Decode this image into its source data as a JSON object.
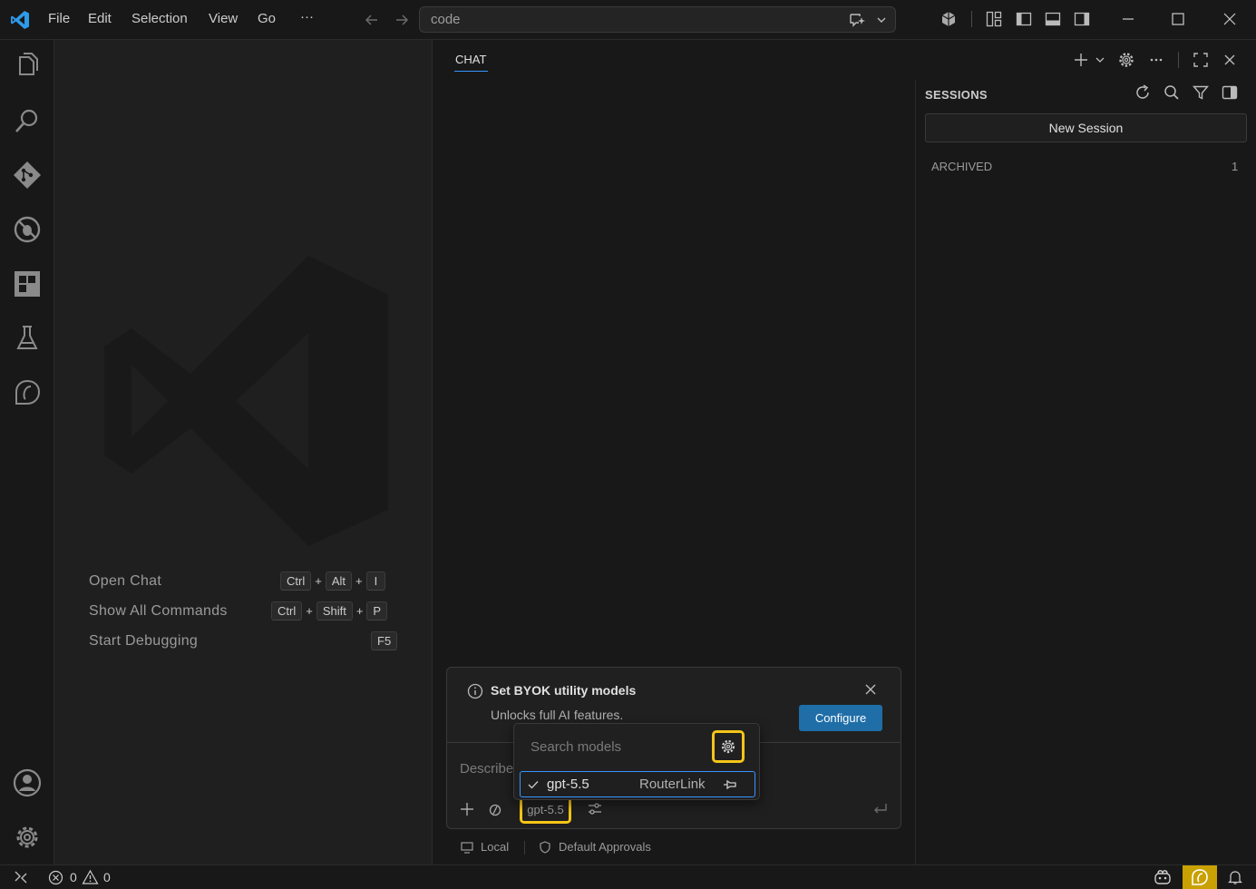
{
  "titlebar": {
    "menu": [
      "File",
      "Edit",
      "Selection",
      "View",
      "Go",
      "···"
    ],
    "search_text": "code"
  },
  "activity_bar": {
    "icons": [
      "explorer-icon",
      "search-icon",
      "source-control-icon",
      "run-debug-icon",
      "extensions-icon",
      "testing-icon",
      "chat-sessions-icon",
      "account-icon",
      "settings-gear-icon"
    ]
  },
  "editor": {
    "hints": [
      {
        "label": "Open Chat",
        "keys": [
          "Ctrl",
          "Alt",
          "I"
        ]
      },
      {
        "label": "Show All Commands",
        "keys": [
          "Ctrl",
          "Shift",
          "P"
        ]
      },
      {
        "label": "Start Debugging",
        "keys": [
          "F5"
        ]
      }
    ],
    "plus": "+"
  },
  "chat": {
    "tab_label": "CHAT",
    "sessions": {
      "title": "SESSIONS",
      "new_session_label": "New Session",
      "archived_label": "ARCHIVED",
      "archived_count": "1"
    },
    "notification": {
      "title": "Set BYOK utility models",
      "description": "Unlocks full AI features.",
      "button_label": "Configure"
    },
    "input": {
      "placeholder": "Describe",
      "model_chip": "gpt-5.5"
    },
    "footer": {
      "local_label": "Local",
      "approvals_label": "Default Approvals"
    },
    "model_dropdown": {
      "search_placeholder": "Search models",
      "selected_model": "gpt-5.5",
      "provider": "RouterLink"
    }
  },
  "statusbar": {
    "errors": "0",
    "warnings": "0"
  },
  "colors": {
    "accent": "#3794ff",
    "highlight": "#f5c518",
    "button": "#1f6ea8",
    "copilot_status": "#c9a100"
  }
}
